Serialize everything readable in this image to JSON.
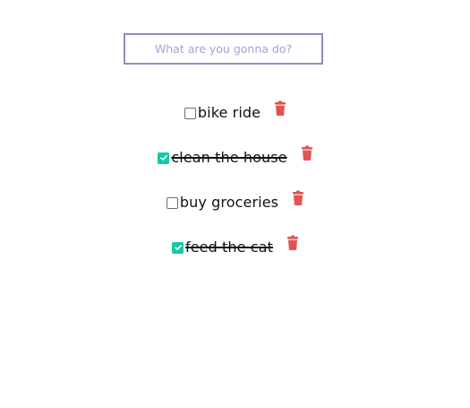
{
  "input": {
    "placeholder": "What are you gonna do?",
    "value": ""
  },
  "todos": [
    {
      "text": "bike ride",
      "done": false
    },
    {
      "text": "clean the house",
      "done": true
    },
    {
      "text": "buy groceries",
      "done": false
    },
    {
      "text": "feed the cat",
      "done": true
    }
  ],
  "colors": {
    "input_border": "#8c8fc8",
    "check_accent": "#14c9a6",
    "delete_icon": "#e05552",
    "text": "#111111"
  },
  "icons": {
    "checkbox_checked": "check-icon",
    "delete": "trash-icon"
  }
}
